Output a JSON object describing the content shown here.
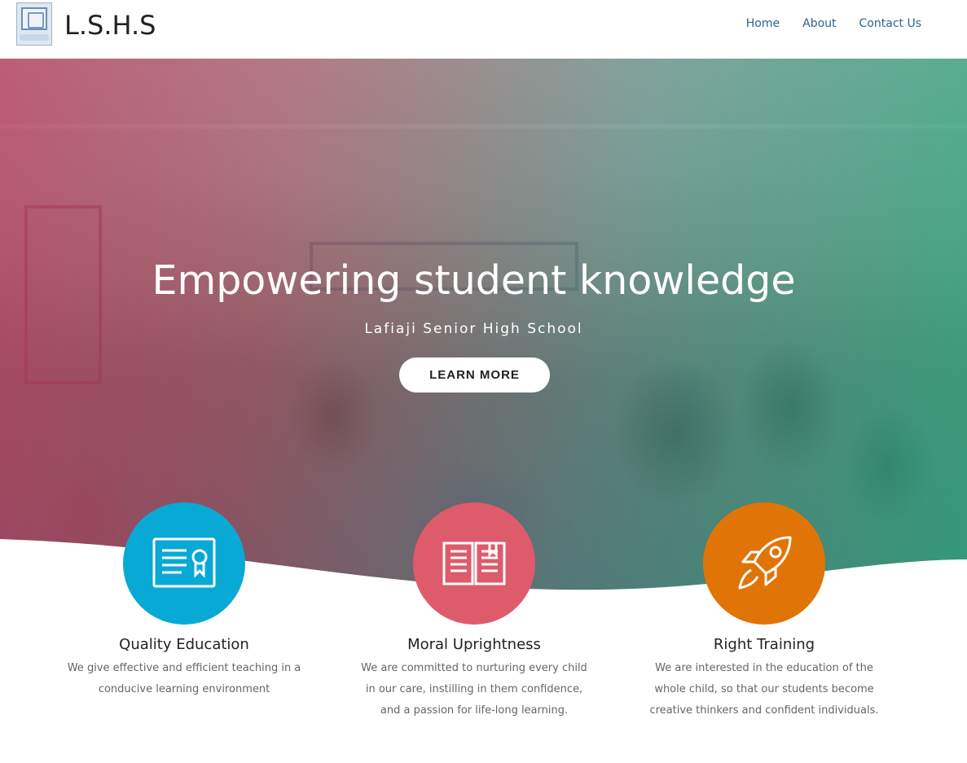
{
  "header": {
    "logo_icon": "school-crest-icon",
    "brand": "L.S.H.S",
    "nav": [
      {
        "label": "Home"
      },
      {
        "label": "About"
      },
      {
        "label": "Contact Us"
      }
    ]
  },
  "hero": {
    "title": "Empowering student knowledge",
    "subtitle": "Lafiaji Senior High School",
    "button": "LEARN MORE",
    "overlay_colors": [
      "#be3c5f",
      "#28af82"
    ]
  },
  "features": [
    {
      "icon": "certificate-icon",
      "color": "#09a9d6",
      "title": "Quality Education",
      "text": "We give effective and efficient teaching in a conducive learning environment"
    },
    {
      "icon": "open-book-icon",
      "color": "#de5b6b",
      "title": "Moral Uprightness",
      "text": "We are committed to nurturing every child in our care, instilling in them confidence, and a passion for life-long learning."
    },
    {
      "icon": "rocket-icon",
      "color": "#e17406",
      "title": "Right Training",
      "text": "We are interested in the education of the whole child, so that our students become creative thinkers and confident individuals."
    }
  ]
}
